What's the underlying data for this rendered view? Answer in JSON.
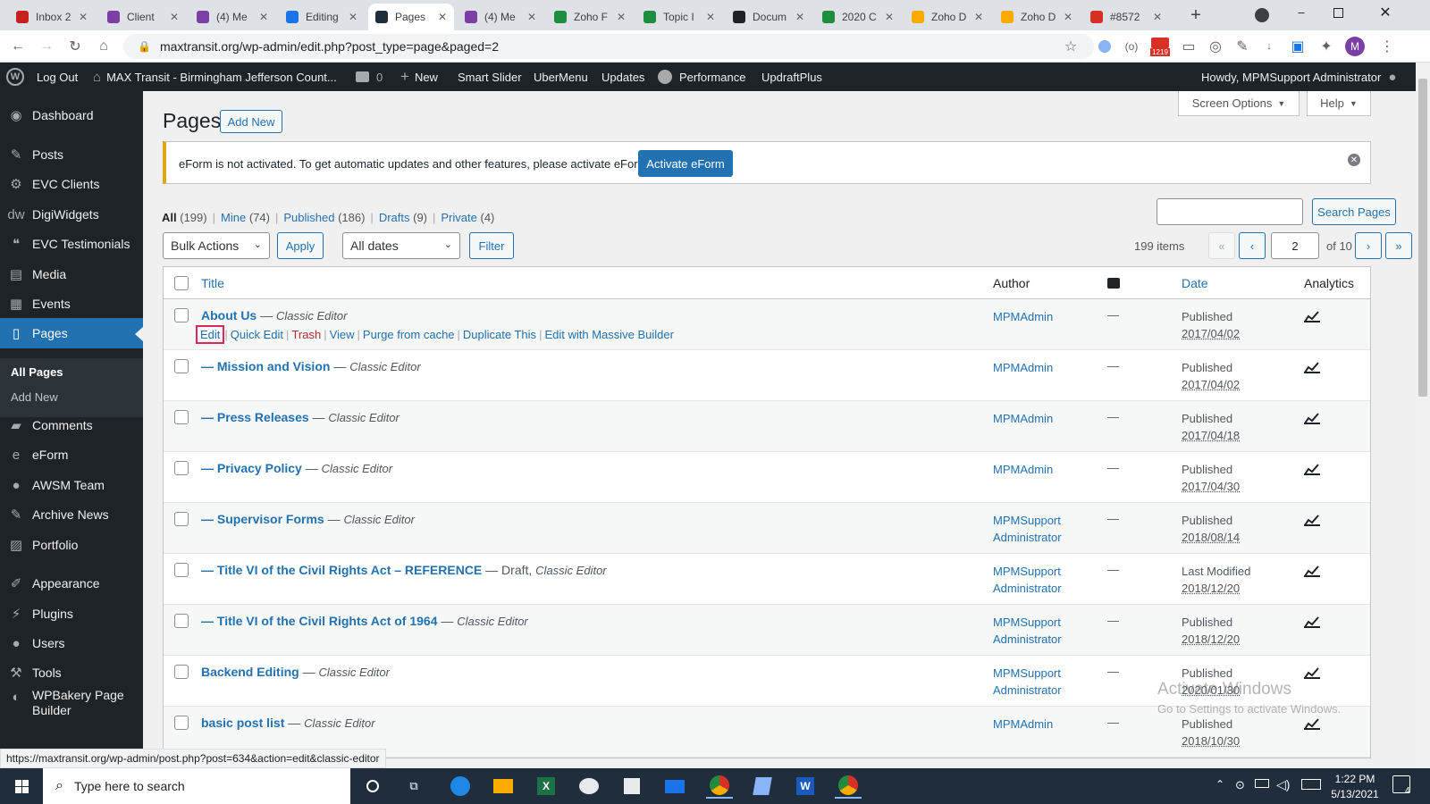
{
  "browser": {
    "tabs": [
      {
        "label": "Inbox 2",
        "color": "#c5221f"
      },
      {
        "label": "Client",
        "color": "#7b3fa6"
      },
      {
        "label": "(4) Me",
        "color": "#7b3fa6"
      },
      {
        "label": "Editing",
        "color": "#1a73e8"
      },
      {
        "label": "Pages",
        "color": "#1f2d3d"
      },
      {
        "label": "(4) Me",
        "color": "#7b3fa6"
      },
      {
        "label": "Zoho F",
        "color": "#1e8e3e"
      },
      {
        "label": "Topic I",
        "color": "#1e8e3e"
      },
      {
        "label": "Docum",
        "color": "#202124"
      },
      {
        "label": "2020 C",
        "color": "#1e8e3e"
      },
      {
        "label": "Zoho D",
        "color": "#f9ab00"
      },
      {
        "label": "Zoho D",
        "color": "#f9ab00"
      },
      {
        "label": "#8572",
        "color": "#d93025"
      }
    ],
    "url": "maxtransit.org/wp-admin/edit.php?post_type=page&paged=2",
    "new_tab_icon": "plus-icon",
    "badge_count": "1219",
    "profile_initial": "M",
    "status_url": "https://maxtransit.org/wp-admin/post.php?post=634&action=edit&classic-editor"
  },
  "adminbar": {
    "logout": "Log Out",
    "site": "MAX Transit - Birmingham Jefferson Count...",
    "comments": "0",
    "new": "New",
    "items": [
      "Smart Slider",
      "UberMenu",
      "Updates",
      "Performance",
      "UpdraftPlus"
    ],
    "howdy": "Howdy, MPMSupport Administrator"
  },
  "sidebar": {
    "items": [
      {
        "label": "Dashboard",
        "icon": "dashboard-icon"
      },
      {
        "label": "Posts",
        "icon": "pin-icon"
      },
      {
        "label": "EVC Clients",
        "icon": "gear-icon"
      },
      {
        "label": "DigiWidgets",
        "icon": "dw-icon"
      },
      {
        "label": "EVC Testimonials",
        "icon": "quote-icon"
      },
      {
        "label": "Media",
        "icon": "media-icon"
      },
      {
        "label": "Events",
        "icon": "calendar-icon"
      },
      {
        "label": "Pages",
        "icon": "pages-icon"
      },
      {
        "label": "Comments",
        "icon": "comment-icon"
      },
      {
        "label": "eForm",
        "icon": "eform-icon"
      },
      {
        "label": "AWSM Team",
        "icon": "user-icon"
      },
      {
        "label": "Archive News",
        "icon": "pin-icon"
      },
      {
        "label": "Portfolio",
        "icon": "portfolio-icon"
      },
      {
        "label": "Appearance",
        "icon": "brush-icon"
      },
      {
        "label": "Plugins",
        "icon": "plugin-icon"
      },
      {
        "label": "Users",
        "icon": "user-icon"
      },
      {
        "label": "Tools",
        "icon": "wrench-icon"
      },
      {
        "label": "WPBakery Page Builder",
        "icon": "wpbakery-icon"
      }
    ],
    "submenu": [
      "All Pages",
      "Add New"
    ]
  },
  "main": {
    "title": "Pages",
    "add_new": "Add New",
    "screen_options": "Screen Options",
    "help": "Help",
    "notice": "eForm is not activated. To get automatic updates and other features, please activate eForm.",
    "activate_button": "Activate eForm",
    "filters": [
      {
        "label": "All",
        "count": "(199)"
      },
      {
        "label": "Mine",
        "count": "(74)"
      },
      {
        "label": "Published",
        "count": "(186)"
      },
      {
        "label": "Drafts",
        "count": "(9)"
      },
      {
        "label": "Private",
        "count": "(4)"
      }
    ],
    "search_button": "Search Pages",
    "bulk_actions": "Bulk Actions",
    "apply": "Apply",
    "all_dates": "All dates",
    "filter": "Filter",
    "items_count": "199 items",
    "page_first": "«",
    "page_prev": "‹",
    "page_next": "›",
    "page_last": "»",
    "current_page": "2",
    "of_pages": "of 10",
    "columns": {
      "title": "Title",
      "author": "Author",
      "date": "Date",
      "analytics": "Analytics"
    },
    "row_actions": [
      "Edit",
      "Quick Edit",
      "Trash",
      "View",
      "Purge from cache",
      "Duplicate This",
      "Edit with Massive Builder"
    ],
    "rows": [
      {
        "title": "About Us",
        "state": "",
        "editor": "Classic Editor",
        "author": [
          "MPMAdmin"
        ],
        "status": "Published",
        "date": "2017/04/02"
      },
      {
        "title": "— Mission and Vision",
        "state": "",
        "editor": "Classic Editor",
        "author": [
          "MPMAdmin"
        ],
        "status": "Published",
        "date": "2017/04/02"
      },
      {
        "title": "— Press Releases",
        "state": "",
        "editor": "Classic Editor",
        "author": [
          "MPMAdmin"
        ],
        "status": "Published",
        "date": "2017/04/18"
      },
      {
        "title": "— Privacy Policy",
        "state": "",
        "editor": "Classic Editor",
        "author": [
          "MPMAdmin"
        ],
        "status": "Published",
        "date": "2017/04/30"
      },
      {
        "title": "— Supervisor Forms",
        "state": "",
        "editor": "Classic Editor",
        "author": [
          "MPMSupport",
          "Administrator"
        ],
        "status": "Published",
        "date": "2018/08/14"
      },
      {
        "title": "— Title VI of the Civil Rights Act – REFERENCE",
        "state": "Draft,",
        "editor": "Classic Editor",
        "author": [
          "MPMSupport",
          "Administrator"
        ],
        "status": "Last Modified",
        "date": "2018/12/20"
      },
      {
        "title": "— Title VI of the Civil Rights Act of 1964",
        "state": "",
        "editor": "Classic Editor",
        "author": [
          "MPMSupport",
          "Administrator"
        ],
        "status": "Published",
        "date": "2018/12/20"
      },
      {
        "title": "Backend Editing",
        "state": "",
        "editor": "Classic Editor",
        "author": [
          "MPMSupport",
          "Administrator"
        ],
        "status": "Published",
        "date": "2020/01/30"
      },
      {
        "title": "basic post list",
        "state": "",
        "editor": "Classic Editor",
        "author": [
          "MPMAdmin"
        ],
        "status": "Published",
        "date": "2018/10/30"
      }
    ],
    "comment_dash": "—"
  },
  "watermark": {
    "line1": "Activate Windows",
    "line2": "Go to Settings to activate Windows."
  },
  "taskbar": {
    "search_placeholder": "Type here to search",
    "time": "1:22 PM",
    "date": "5/13/2021",
    "notification_count": "4"
  },
  "colors": {
    "wp_dark": "#1d2327",
    "wp_blue": "#2271b1",
    "highlight": "#e0245e",
    "taskbar": "#1f2d3d"
  }
}
